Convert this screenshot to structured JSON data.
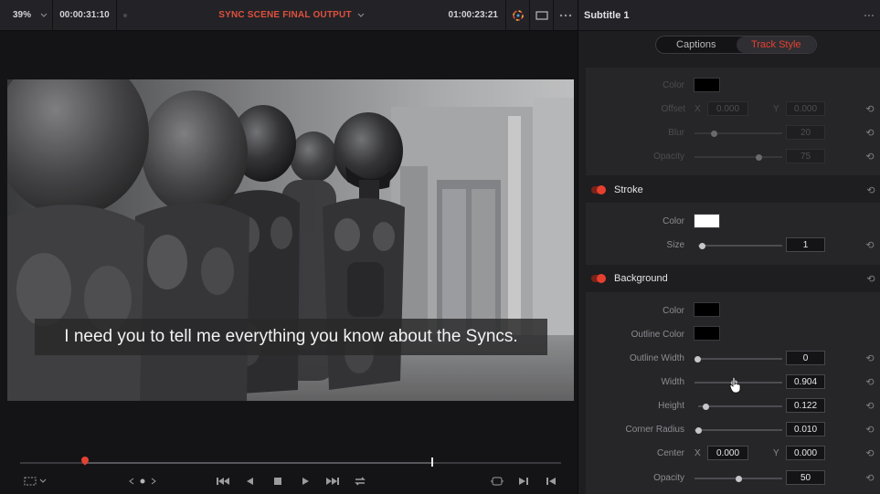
{
  "viewer": {
    "zoom": "39%",
    "source_timecode": "00:00:31:10",
    "timeline_name": "SYNC SCENE FINAL OUTPUT",
    "record_timecode": "01:00:23:21",
    "subtitle_text": "I need you to tell me everything you know about the Syncs.",
    "playhead_fraction": 0.12,
    "out_point_fraction": 0.76,
    "icons": {
      "zoom_menu": "chevron-down-icon",
      "title_menu": "chevron-down-icon",
      "color_wheel": "color-wheel-icon",
      "viewer_mode": "rectangle-icon",
      "more": "more-icon",
      "safe_area": "safe-area-icon",
      "nav_prev": "chevron-left-icon",
      "nav_dot": "dot-icon",
      "nav_next": "chevron-right-icon",
      "first_frame": "skip-to-start-icon",
      "play_reverse": "play-reverse-icon",
      "stop": "stop-icon",
      "play": "play-icon",
      "last_frame": "skip-to-end-icon",
      "loop": "loop-icon",
      "match_frame": "match-frame-icon",
      "next_edit": "next-edit-icon",
      "prev_edit": "previous-edit-icon"
    }
  },
  "inspector": {
    "title": "Subtitle 1",
    "tabs": [
      {
        "label": "Captions",
        "active": false
      },
      {
        "label": "Track Style",
        "active": true
      }
    ],
    "shadow": {
      "color_label": "Color",
      "color": "#000000",
      "offset_label": "Offset",
      "offset_x_label": "X",
      "offset_x": "0.000",
      "offset_y_label": "Y",
      "offset_y": "0.000",
      "blur_label": "Blur",
      "blur": "20",
      "blur_level": 0.2,
      "opacity_label": "Opacity",
      "opacity": "75",
      "opacity_level": 0.75
    },
    "stroke": {
      "title": "Stroke",
      "enabled": true,
      "color_label": "Color",
      "color": "#ffffff",
      "size_label": "Size",
      "size": "1",
      "size_level": 0.01
    },
    "background": {
      "title": "Background",
      "enabled": true,
      "color_label": "Color",
      "color": "#000000",
      "outline_color_label": "Outline Color",
      "outline_color": "#000000",
      "outline_width_label": "Outline Width",
      "outline_width": "0",
      "outline_width_level": 0.0,
      "width_label": "Width",
      "width": "0.904",
      "width_level": 0.45,
      "height_label": "Height",
      "height": "0.122",
      "height_level": 0.06,
      "corner_radius_label": "Corner Radius",
      "corner_radius": "0.010",
      "corner_radius_level": 0.01,
      "center_label": "Center",
      "center_x_label": "X",
      "center_x": "0.000",
      "center_y_label": "Y",
      "center_y": "0.000",
      "opacity_label": "Opacity",
      "opacity": "50",
      "opacity_level": 0.5
    },
    "accent": "#e5402f"
  }
}
